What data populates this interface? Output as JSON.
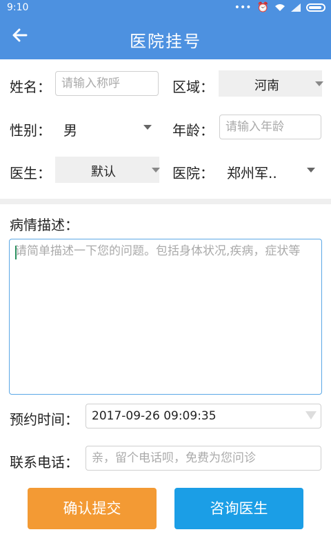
{
  "status": {
    "time": "9:10",
    "dots": "•••"
  },
  "header": {
    "title": "医院挂号"
  },
  "form": {
    "name_label": "姓名：",
    "name_placeholder": "请输入称呼",
    "region_label": "区域：",
    "region_value": "河南",
    "gender_label": "性别：",
    "gender_value": "男",
    "age_label": "年龄：",
    "age_placeholder": "请输入年龄",
    "doctor_label": "医生：",
    "doctor_value": "默认",
    "hospital_label": "医院：",
    "hospital_value": "郑州军..",
    "desc_label": "病情描述：",
    "desc_placeholder": "请简单描述一下您的问题。包括身体状况,疾病，症状等",
    "time_label": "预约时间：",
    "time_value": "2017-09-26 09:09:35",
    "phone_label": "联系电话：",
    "phone_placeholder": "亲，留个电话呗，免费为您问诊"
  },
  "buttons": {
    "submit": "确认提交",
    "consult": "咨询医生"
  },
  "colors": {
    "primary": "#4d91e0",
    "submit": "#f39a34",
    "consult": "#1b9ee6"
  }
}
